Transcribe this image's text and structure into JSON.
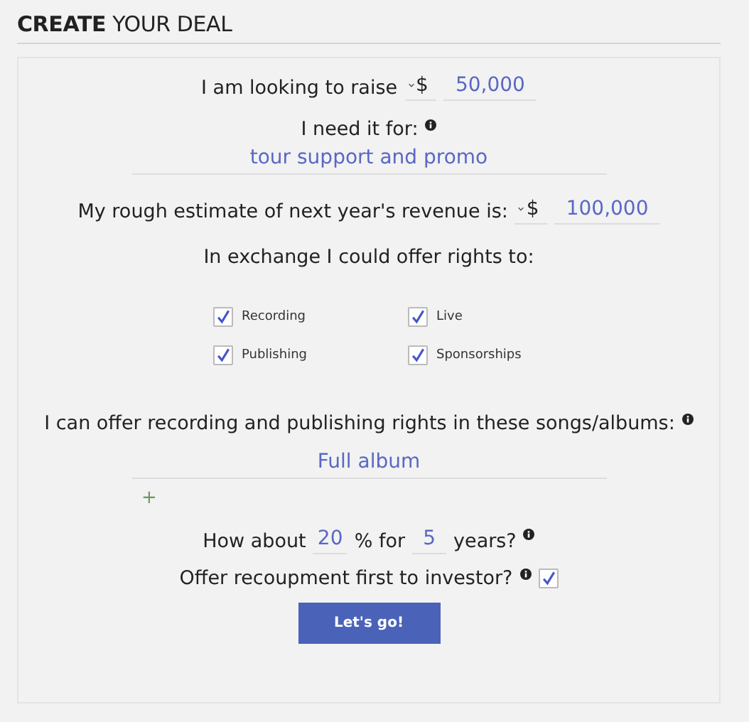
{
  "heading": "**CREATE** YOUR DEAL",
  "raise": {
    "label": "I am looking to raise",
    "currency": "$",
    "amount": "50,000"
  },
  "purpose": {
    "label": "I need it for:",
    "value": "tour support and promo"
  },
  "revenue": {
    "label": "My rough estimate of next year's revenue is:",
    "currency": "$",
    "amount": "100,000"
  },
  "rights": {
    "label": "In exchange I could offer rights to:",
    "options": [
      {
        "label": "Recording",
        "checked": true
      },
      {
        "label": "Live",
        "checked": true
      },
      {
        "label": "Publishing",
        "checked": true
      },
      {
        "label": "Sponsorships",
        "checked": true
      }
    ]
  },
  "songs": {
    "label": "I can offer recording and publishing rights in these songs/albums:",
    "value": "Full album",
    "add": "+"
  },
  "terms": {
    "before": "How about",
    "percent": "20",
    "middle": "% for",
    "years": "5",
    "after": "years?"
  },
  "recoupment": {
    "label": "Offer recoupment first to investor?",
    "checked": true
  },
  "submit": "Let's go!"
}
